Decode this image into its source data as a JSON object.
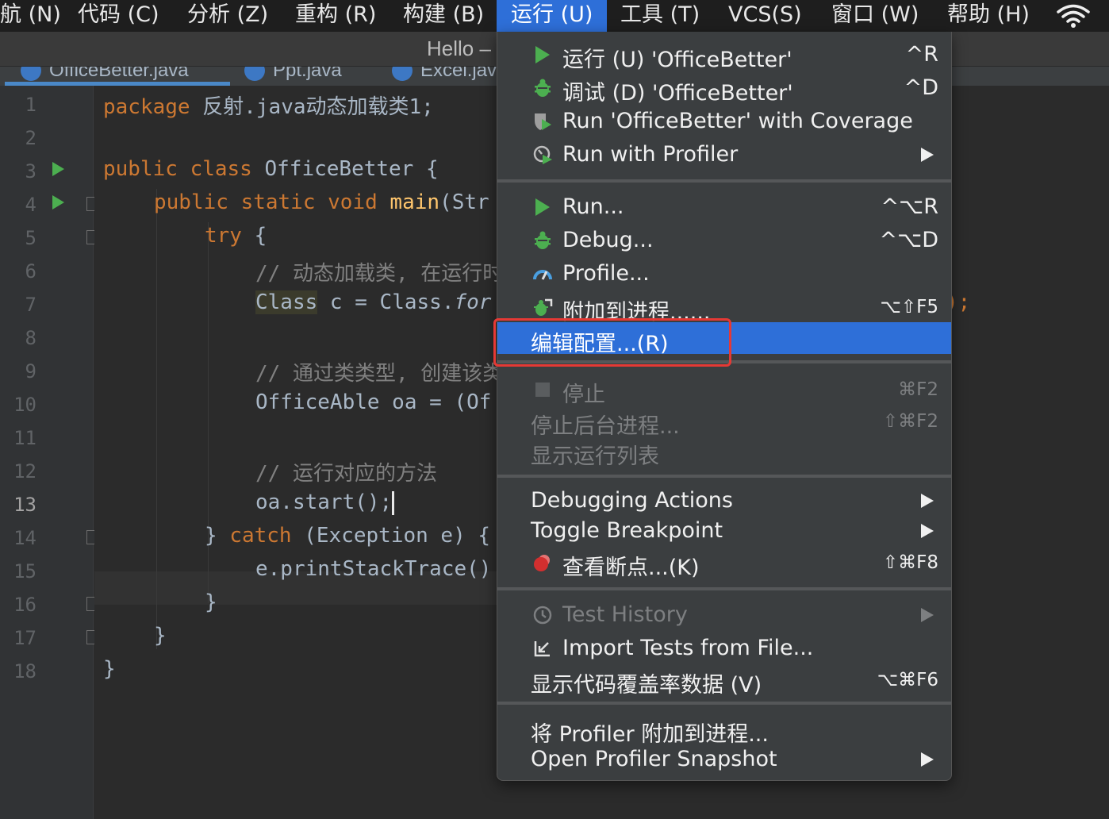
{
  "menubar": {
    "items": [
      "航 (N)",
      "代码 (C)",
      "分析 (Z)",
      "重构 (R)",
      "构建 (B)",
      "运行 (U)",
      "工具 (T)",
      "VCS(S)",
      "窗口 (W)",
      "帮助 (H)"
    ]
  },
  "titlebar": {
    "title": "Hello –"
  },
  "tabs": [
    "OfficeBetter.java",
    "Ppt.java",
    "Excel.java"
  ],
  "editor": {
    "line_numbers": [
      "1",
      "2",
      "3",
      "4",
      "5",
      "6",
      "7",
      "8",
      "9",
      "10",
      "11",
      "12",
      "13",
      "14",
      "15",
      "16",
      "17",
      "18"
    ],
    "current_line": "13",
    "lines": {
      "l1_kw": "package",
      "l1_rest": " 反射.java动态加载类1;",
      "l3_kw": "public class",
      "l3_rest": " OfficeBetter {",
      "l4_kw": "public static void",
      "l4_fn": " main",
      "l4_rest": "(Str",
      "l5_kw": "try",
      "l5_rest": " {",
      "l6_cm": "// 动态加载类, 在运行时",
      "l7_hl": "Class",
      "l7_rest": " c = Class.",
      "l7_it": "for",
      "l9_cm": "// 通过类类型, 创建该类",
      "l10": "OfficeAble oa = (Of",
      "l12_cm": "// 运行对应的方法",
      "l13": "oa.start();",
      "l14_a": "} ",
      "l14_kw": "catch",
      "l14_rest": " (Exception e) {",
      "l15": "e.printStackTrace()",
      "l16": "}",
      "l17": "}",
      "l18": "}",
      "l7_tail": ");"
    }
  },
  "run_menu": {
    "items": [
      {
        "label": "运行 (U) 'OfficeBetter'",
        "shortcut": "^R",
        "icon": "run-icon"
      },
      {
        "label": "调试 (D) 'OfficeBetter'",
        "shortcut": "^D",
        "icon": "debug-icon"
      },
      {
        "label": "Run 'OfficeBetter' with Coverage",
        "shortcut": "",
        "icon": "coverage-icon"
      },
      {
        "label": "Run with Profiler",
        "shortcut": "",
        "icon": "profiler-icon",
        "submenu": true
      },
      {
        "label": "Run...",
        "shortcut": "^⌥R",
        "icon": "run-icon"
      },
      {
        "label": "Debug...",
        "shortcut": "^⌥D",
        "icon": "debug-icon"
      },
      {
        "label": "Profile...",
        "shortcut": "",
        "icon": "profile-icon"
      },
      {
        "label": "附加到进程......",
        "shortcut": "⌥⇧F5",
        "icon": "attach-icon"
      },
      {
        "label": "编辑配置...(R)",
        "shortcut": "",
        "selected": true
      },
      {
        "label": "停止",
        "shortcut": "⌘F2",
        "icon": "stop-icon",
        "disabled": true
      },
      {
        "label": "停止后台进程...",
        "shortcut": "⇧⌘F2",
        "disabled": true
      },
      {
        "label": "显示运行列表",
        "shortcut": "",
        "disabled": true
      },
      {
        "label": "Debugging Actions",
        "shortcut": "",
        "submenu": true
      },
      {
        "label": "Toggle Breakpoint",
        "shortcut": "",
        "submenu": true
      },
      {
        "label": "查看断点...(K)",
        "shortcut": "⇧⌘F8",
        "icon": "breakpoints-icon"
      },
      {
        "label": "Test History",
        "shortcut": "",
        "icon": "history-icon",
        "submenu": true,
        "disabled": true
      },
      {
        "label": "Import Tests from File...",
        "shortcut": "",
        "icon": "import-icon"
      },
      {
        "label": "显示代码覆盖率数据 (V)",
        "shortcut": "⌥⌘F6"
      },
      {
        "label": "将 Profiler 附加到进程...",
        "shortcut": ""
      },
      {
        "label": "Open Profiler Snapshot",
        "shortcut": "",
        "submenu": true
      }
    ]
  },
  "colors": {
    "accent": "#2e6fd8",
    "highlight_box": "#e53935",
    "run_green": "#4caf50"
  }
}
